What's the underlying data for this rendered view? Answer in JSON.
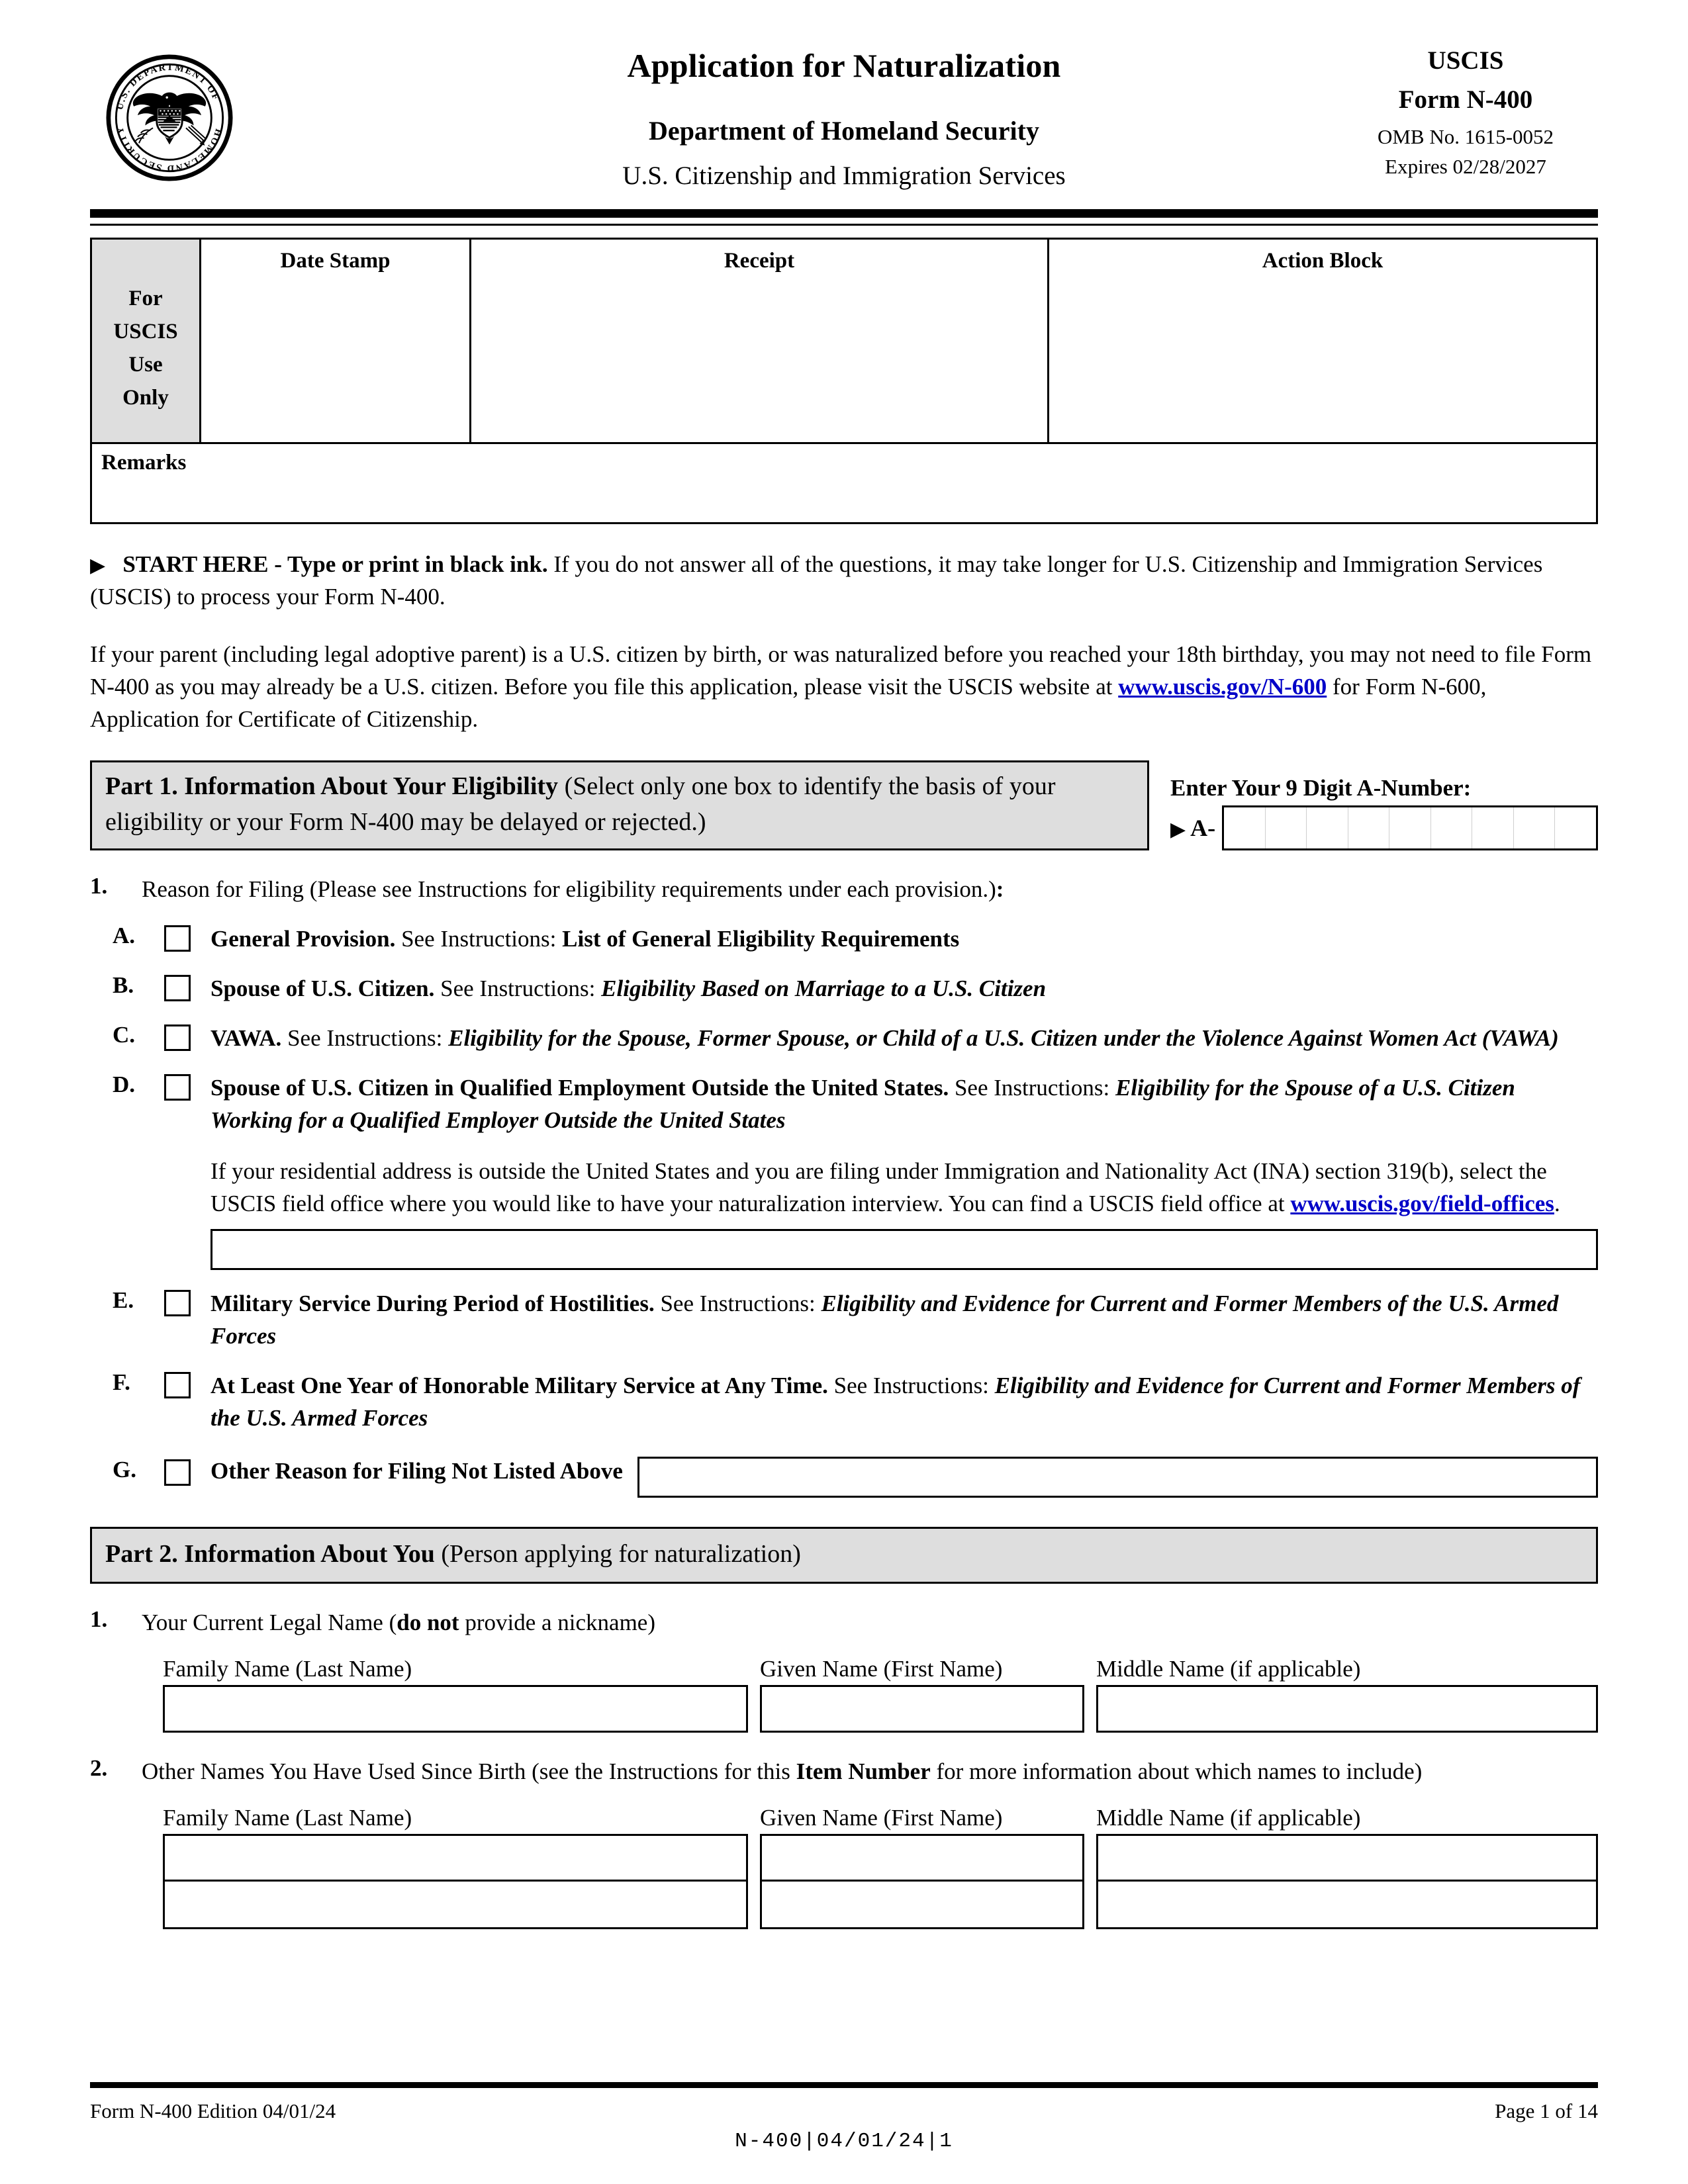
{
  "header": {
    "title": "Application for Naturalization",
    "subtitle1": "Department of Homeland Security",
    "subtitle2": "U.S. Citizenship and Immigration Services",
    "agency": "USCIS",
    "form_number": "Form N-400",
    "omb": "OMB No. 1615-0052",
    "expires": "Expires 02/28/2027",
    "seal_alt": "U.S. Department of Homeland Security seal"
  },
  "uscis_block": {
    "side_label": "For USCIS Use Only",
    "side_label_lines": [
      "For",
      "USCIS",
      "Use",
      "Only"
    ],
    "columns": [
      "Date Stamp",
      "Receipt",
      "Action Block"
    ],
    "remarks_label": "Remarks"
  },
  "instructions": {
    "arrow": "▶",
    "start_here_bold": "START HERE - Type or print in black ink.",
    "start_here_rest": " If you do not answer all of the questions, it may take longer for U.S. Citizenship and Immigration Services (USCIS) to process your Form N-400.",
    "paragraph2_part1": "If your parent (including legal adoptive parent) is a U.S. citizen by birth, or was naturalized before you reached your 18th birthday, you may not need to file Form N-400 as you may already be a U.S. citizen.  Before you file this application, please visit the USCIS website at ",
    "paragraph2_link": "www.uscis.gov/N-600",
    "paragraph2_part2": " for Form N-600, Application for Certificate of Citizenship."
  },
  "part1": {
    "bar_title": "Part 1.  Information About Your Eligibility ",
    "bar_note": "(Select only one box to identify the basis of your eligibility or your Form N-400 may be delayed or rejected.)",
    "anumber_label": "Enter Your 9 Digit A-Number:",
    "anumber_arrow": "▶",
    "anumber_prefix": "A-",
    "anumber_cells": 9,
    "anumber_value": "",
    "item1_number": "1.",
    "item1_text_a": "Reason for Filing (Please see Instructions for eligibility requirements under each provision.)",
    "item1_text_b": ":",
    "options": [
      {
        "letter": "A.",
        "bold": "General Provision.",
        "plain": "  See Instructions:  ",
        "emphasis": "List of General Eligibility Requirements",
        "emphasis_style": "bold",
        "checked": false
      },
      {
        "letter": "B.",
        "bold": "Spouse of U.S. Citizen.",
        "plain": "  See Instructions:  ",
        "emphasis": "Eligibility Based on Marriage to a U.S. Citizen",
        "emphasis_style": "bolditalic",
        "checked": false
      },
      {
        "letter": "C.",
        "bold": "VAWA.",
        "plain": "  See Instructions:  ",
        "emphasis": "Eligibility for the Spouse, Former Spouse, or Child of a U.S. Citizen under the Violence Against Women Act (VAWA)",
        "emphasis_style": "bolditalic",
        "checked": false
      },
      {
        "letter": "D.",
        "bold": "Spouse of U.S. Citizen in Qualified Employment Outside the United States.",
        "plain": "  See Instructions:  ",
        "emphasis": "Eligibility for the Spouse of a U.S. Citizen Working for a Qualified Employer Outside the United States",
        "emphasis_style": "bolditalic",
        "checked": false
      },
      {
        "letter": "E.",
        "bold": "Military Service During Period of Hostilities.",
        "plain": "  See Instructions:  ",
        "emphasis": "Eligibility and Evidence for Current and Former Members of the U.S. Armed Forces",
        "emphasis_style": "bolditalic",
        "checked": false
      },
      {
        "letter": "F.",
        "bold": "At Least One Year of Honorable Military Service at Any Time.",
        "plain": "  See Instructions:  ",
        "emphasis": "Eligibility and Evidence for Current and Former Members of the U.S. Armed Forces",
        "emphasis_style": "bolditalic",
        "checked": false
      }
    ],
    "option_d_note_part1": "If your residential address is outside the United States and you are filing under Immigration and Nationality Act (INA) section 319(b), select the USCIS field office where you would like to have your naturalization interview.  You can find a USCIS field office at ",
    "option_d_note_link": "www.uscis.gov/field-offices",
    "option_d_note_part2": ".",
    "option_d_field_value": "",
    "option_g": {
      "letter": "G.",
      "label": "Other Reason for Filing Not Listed Above",
      "value": "",
      "checked": false
    }
  },
  "part2": {
    "bar_title": "Part 2.  Information About You ",
    "bar_note": "(Person applying for naturalization)",
    "item1": {
      "number": "1.",
      "text_a": "Your Current Legal Name (",
      "text_bold": "do not",
      "text_b": " provide a nickname)",
      "columns": [
        "Family Name (Last Name)",
        "Given Name (First Name)",
        "Middle Name (if applicable)"
      ],
      "values": [
        "",
        "",
        ""
      ]
    },
    "item2": {
      "number": "2.",
      "text_a": "Other Names You Have Used Since Birth (see the Instructions for this ",
      "text_bold": "Item Number",
      "text_b": " for more information about which names to include)",
      "columns": [
        "Family Name (Last Name)",
        "Given Name (First Name)",
        "Middle Name (if applicable)"
      ],
      "rows": [
        [
          "",
          "",
          ""
        ],
        [
          "",
          "",
          ""
        ]
      ]
    }
  },
  "footer": {
    "left": "Form N-400   Edition   04/01/24",
    "right": "Page 1 of 14",
    "code": "N-400|04/01/24|1"
  },
  "colors": {
    "shade_gray": "#dedede",
    "link_blue": "#0000c8",
    "rule_black": "#000000"
  }
}
